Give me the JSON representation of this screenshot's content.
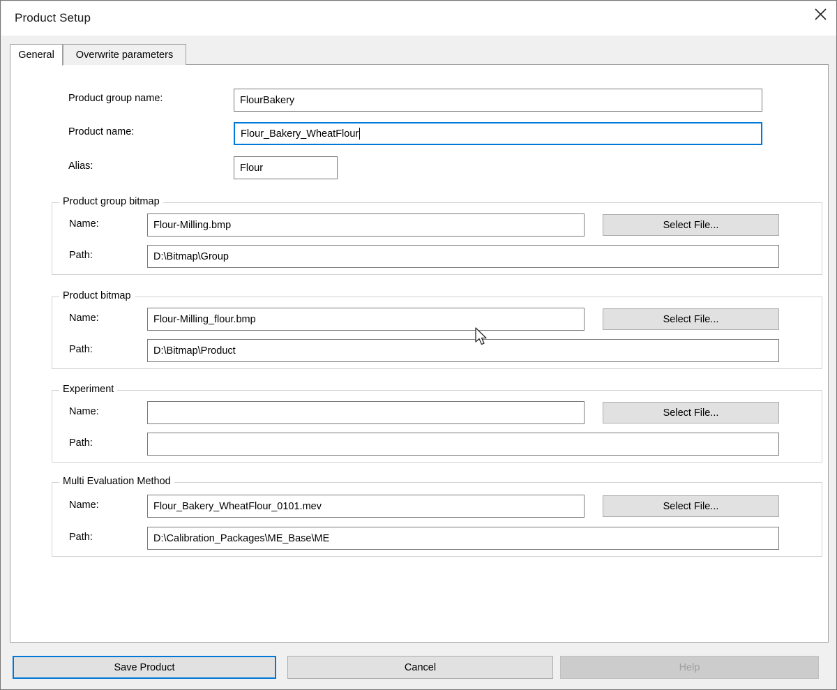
{
  "window": {
    "title": "Product Setup",
    "close_icon": "close-icon"
  },
  "tabs": [
    {
      "label": "General",
      "active": true
    },
    {
      "label": "Overwrite parameters",
      "active": false
    }
  ],
  "form": {
    "product_group_name": {
      "label": "Product group name:",
      "value": "FlourBakery"
    },
    "product_name": {
      "label": "Product name:",
      "value": "Flour_Bakery_WheatFlour",
      "focused": true
    },
    "alias": {
      "label": "Alias:",
      "value": "Flour"
    }
  },
  "groups": [
    {
      "title": "Product group bitmap",
      "name_label": "Name:",
      "name_value": "Flour-Milling.bmp",
      "path_label": "Path:",
      "path_value": "D:\\Bitmap\\Group",
      "select_file_label": "Select File..."
    },
    {
      "title": "Product bitmap",
      "name_label": "Name:",
      "name_value": "Flour-Milling_flour.bmp",
      "path_label": "Path:",
      "path_value": "D:\\Bitmap\\Product",
      "select_file_label": "Select File..."
    },
    {
      "title": "Experiment",
      "name_label": "Name:",
      "name_value": "",
      "path_label": "Path:",
      "path_value": "",
      "select_file_label": "Select File..."
    },
    {
      "title": "Multi Evaluation Method",
      "name_label": "Name:",
      "name_value": "Flour_Bakery_WheatFlour_0101.mev",
      "path_label": "Path:",
      "path_value": "D:\\Calibration_Packages\\ME_Base\\ME",
      "select_file_label": "Select File..."
    }
  ],
  "footer": {
    "save_label": "Save Product",
    "cancel_label": "Cancel",
    "help_label": "Help"
  },
  "colors": {
    "accent": "#0078d7",
    "window_bg": "#f0f0f0",
    "panel_bg": "#ffffff",
    "button_bg": "#e1e1e1",
    "disabled_bg": "#cccccc"
  }
}
